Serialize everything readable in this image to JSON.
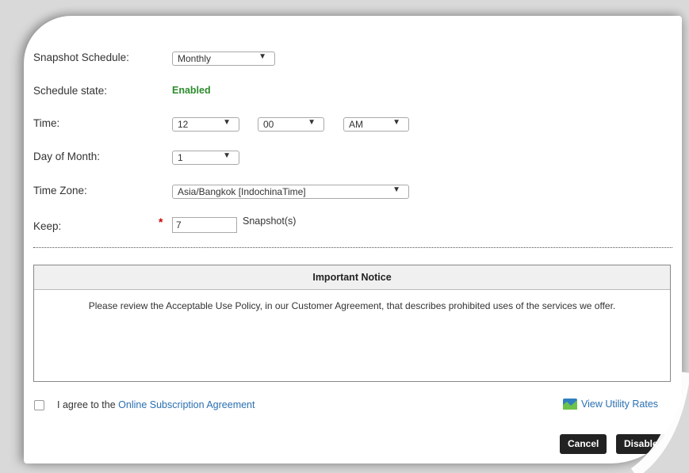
{
  "form": {
    "schedule_label": "Snapshot Schedule:",
    "schedule_value": "Monthly",
    "state_label": "Schedule state:",
    "state_value": "Enabled",
    "time_label": "Time:",
    "hour_value": "12",
    "minute_value": "00",
    "ampm_value": "AM",
    "day_label": "Day of Month:",
    "day_value": "1",
    "timezone_label": "Time Zone:",
    "timezone_value": "Asia/Bangkok [IndochinaTime]",
    "keep_label": "Keep:",
    "keep_required": "*",
    "keep_value": "7",
    "keep_unit": "Snapshot(s)",
    "dropdown_arrow": "▼"
  },
  "notice": {
    "title": "Important Notice",
    "body": "Please review the Acceptable Use Policy, in our Customer Agreement, that describes prohibited uses of the services we offer."
  },
  "footer": {
    "agree_prefix": "I agree to the",
    "agree_link": "Online Subscription Agreement",
    "rates_link": "View Utility Rates",
    "rates_icon": "chart-icon",
    "cancel_label": "Cancel",
    "disable_label": "Disable"
  },
  "colors": {
    "enabled_green": "#2e8b2e",
    "link_blue": "#2a6fb0",
    "required_red": "#cc0000",
    "button_dark": "#222222"
  }
}
